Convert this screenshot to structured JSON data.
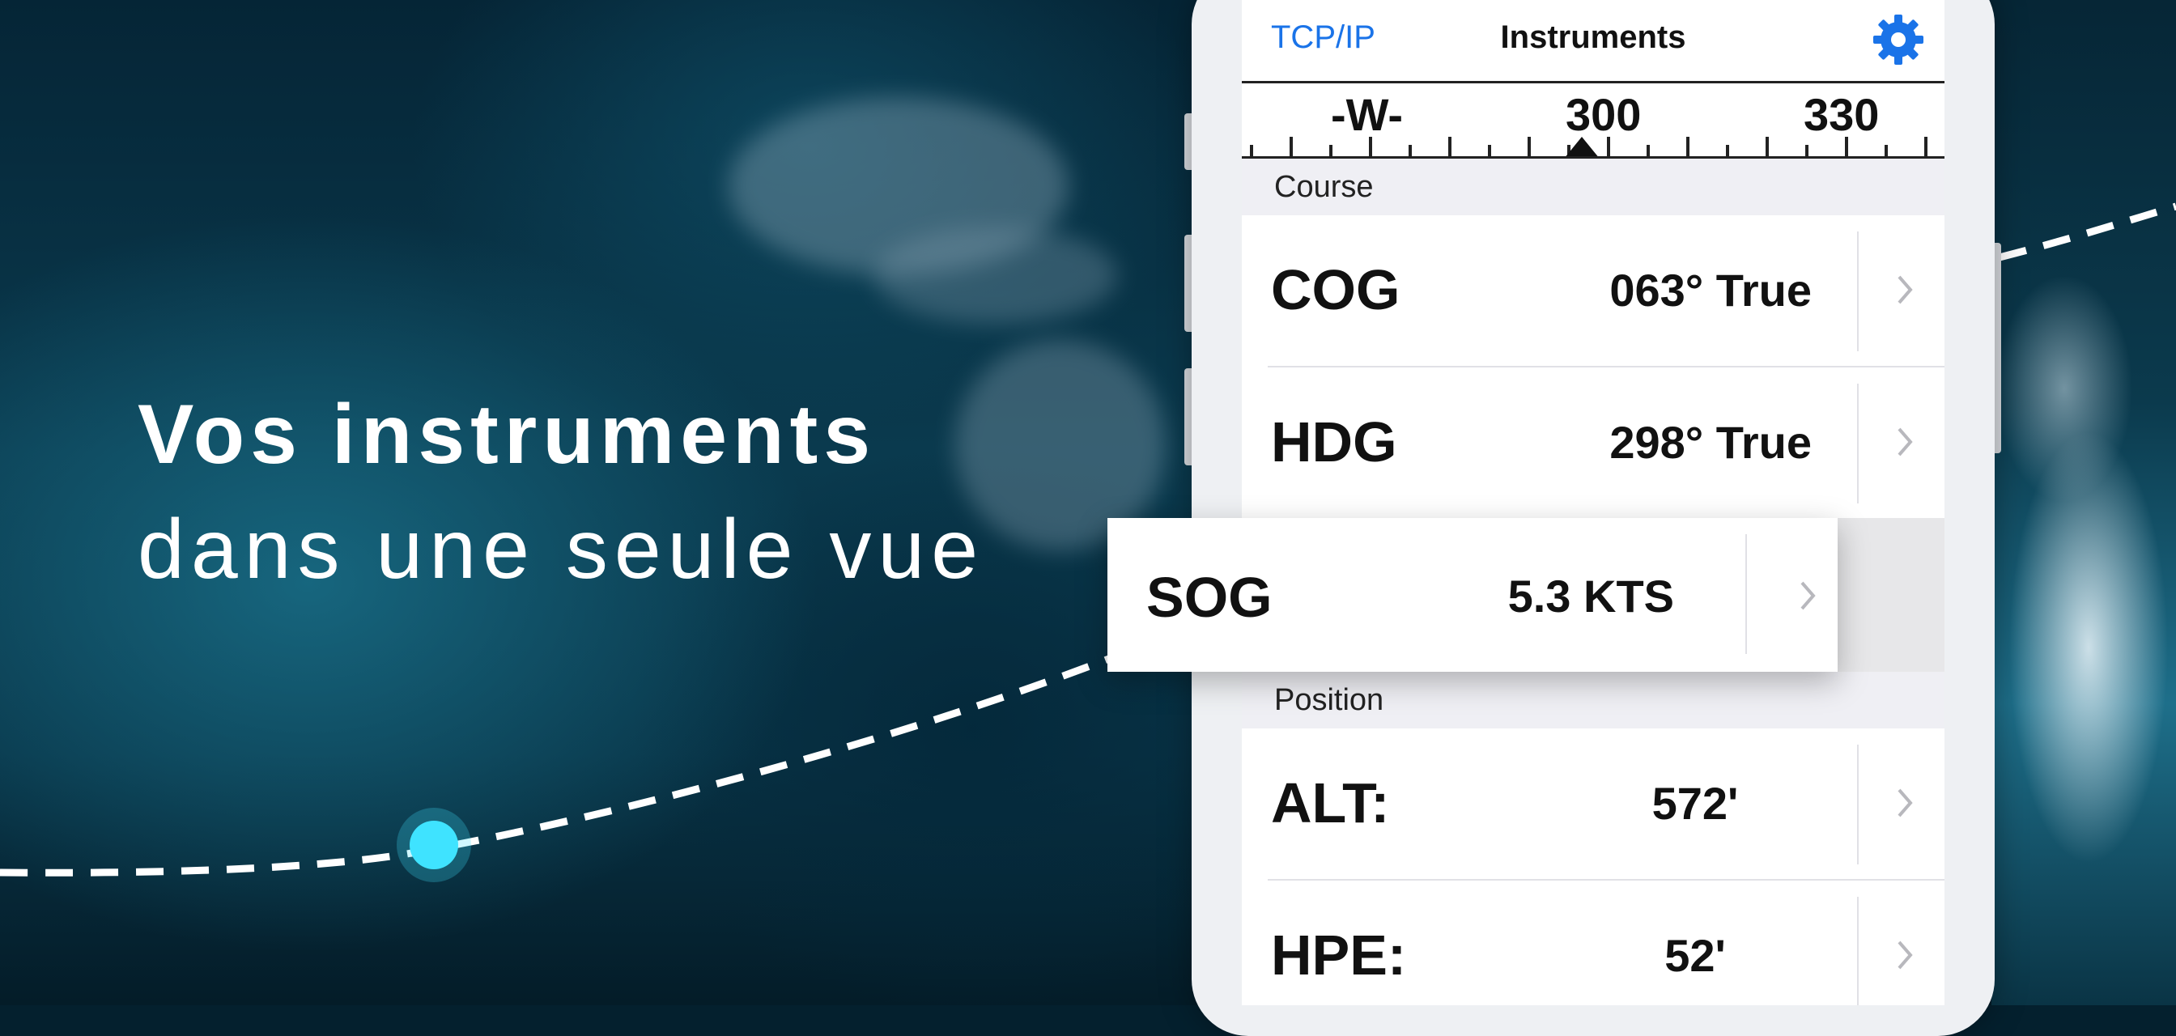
{
  "headline": "Vos instruments",
  "subline": "dans une seule vue",
  "navbar": {
    "left_label": "TCP/IP",
    "title": "Instruments",
    "settings_icon": "gear-icon",
    "accent_color": "#1a73e8"
  },
  "compass": {
    "labels": [
      "-W-",
      "300",
      "330"
    ],
    "pointer_icon": "triangle-up-icon"
  },
  "sections": {
    "course": "Course",
    "position": "Position"
  },
  "rows": {
    "cog": {
      "name": "COG",
      "value": "063° True"
    },
    "hdg": {
      "name": "HDG",
      "value": "298° True"
    },
    "sog": {
      "name": "SOG",
      "value": "5.3 KTS"
    },
    "alt": {
      "name": "ALT:",
      "value": "572'"
    },
    "hpe": {
      "name": "HPE:",
      "value": "52'"
    }
  },
  "route": {
    "marker_color": "#3fe3ff"
  }
}
